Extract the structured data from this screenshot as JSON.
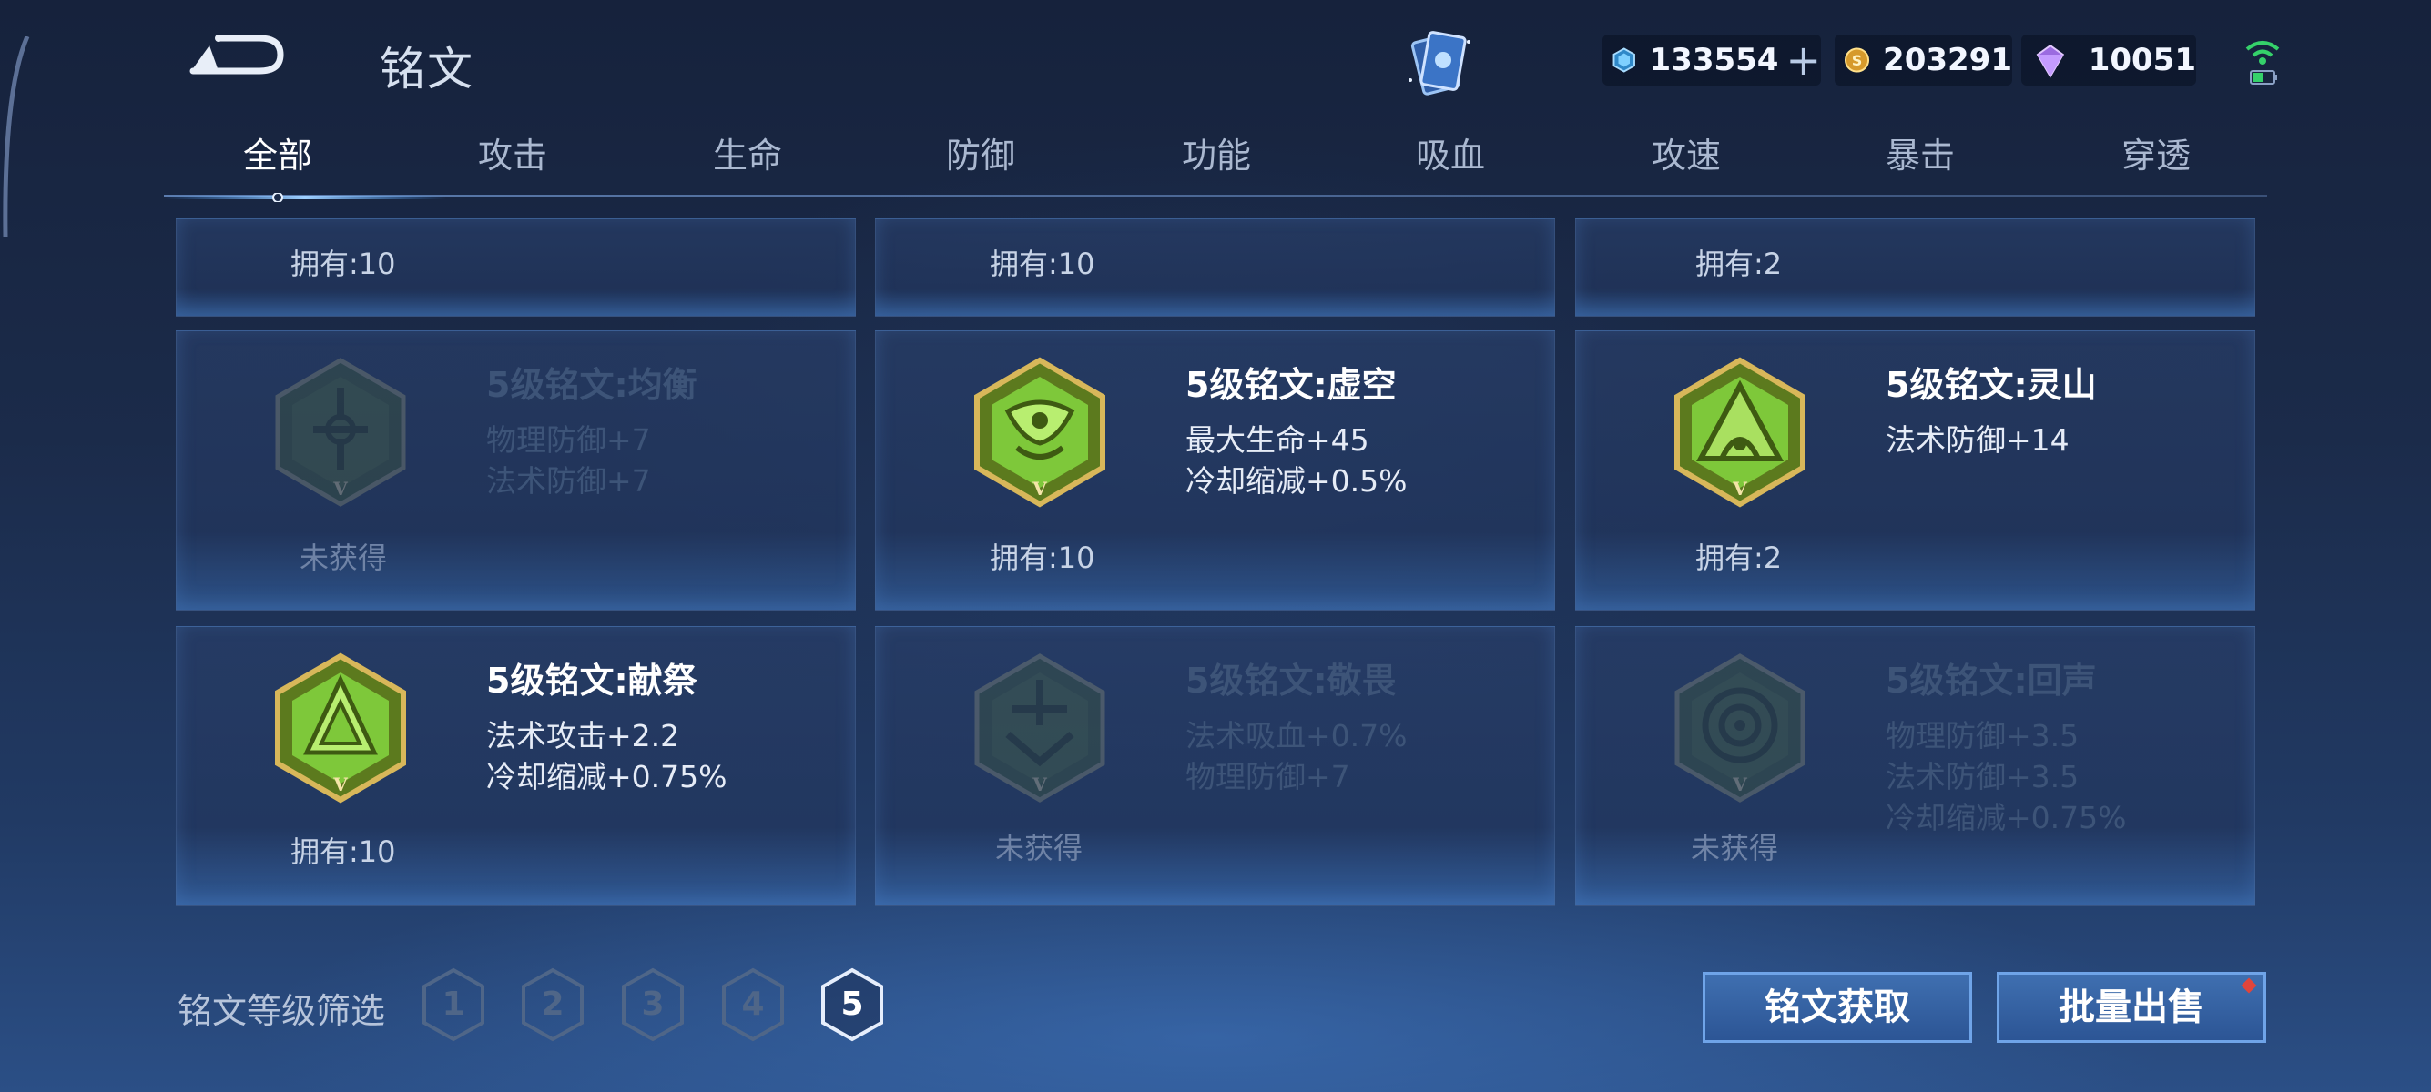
{
  "header": {
    "title": "铭文",
    "currencies": [
      {
        "name": "gem",
        "value": "133554",
        "icon": "diamond-coupon-icon"
      },
      {
        "name": "gold",
        "value": "203291",
        "icon": "gold-coin-icon"
      },
      {
        "name": "crystal",
        "value": "10051",
        "icon": "purple-crystal-icon"
      }
    ]
  },
  "tabs": [
    "全部",
    "攻击",
    "生命",
    "防御",
    "功能",
    "吸血",
    "攻速",
    "暴击",
    "穿透"
  ],
  "active_tab": "全部",
  "partial_row": [
    "拥有:10",
    "拥有:10",
    "拥有:2"
  ],
  "cards": [
    {
      "name": "5级铭文:均衡",
      "stats": [
        "物理防御+7",
        "法术防御+7"
      ],
      "status": "未获得",
      "owned": false
    },
    {
      "name": "5级铭文:虚空",
      "stats": [
        "最大生命+45",
        "冷却缩减+0.5%"
      ],
      "status": "拥有:10",
      "owned": true
    },
    {
      "name": "5级铭文:灵山",
      "stats": [
        "法术防御+14"
      ],
      "status": "拥有:2",
      "owned": true
    },
    {
      "name": "5级铭文:献祭",
      "stats": [
        "法术攻击+2.2",
        "冷却缩减+0.75%"
      ],
      "status": "拥有:10",
      "owned": true
    },
    {
      "name": "5级铭文:敬畏",
      "stats": [
        "法术吸血+0.7%",
        "物理防御+7"
      ],
      "status": "未获得",
      "owned": false
    },
    {
      "name": "5级铭文:回声",
      "stats": [
        "物理防御+3.5",
        "法术防御+3.5",
        "冷却缩减+0.75%"
      ],
      "status": "未获得",
      "owned": false
    }
  ],
  "filter": {
    "label": "铭文等级筛选",
    "levels": [
      "1",
      "2",
      "3",
      "4",
      "5"
    ],
    "selected": "5"
  },
  "buttons": {
    "acquire": "铭文获取",
    "bulk_sell": "批量出售"
  },
  "colors": {
    "accent_blue": "#6fa4e8",
    "emblem_green": "#7ec83a",
    "emblem_gold": "#c9a64a",
    "notification_red": "#e0453c"
  }
}
